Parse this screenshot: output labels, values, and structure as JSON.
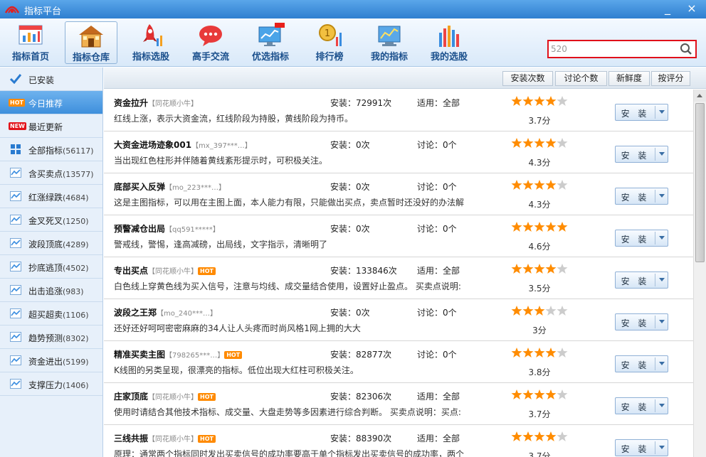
{
  "window": {
    "title": "指标平台",
    "minimize": "_",
    "close": "×"
  },
  "toolbar": {
    "items": [
      {
        "label": "指标首页",
        "icon": "home-chart-icon"
      },
      {
        "label": "指标仓库",
        "icon": "warehouse-icon",
        "active": true
      },
      {
        "label": "指标选股",
        "icon": "rocket-icon"
      },
      {
        "label": "高手交流",
        "icon": "chat-bubble-icon"
      },
      {
        "label": "优选指标",
        "icon": "monitor-chart-icon",
        "badge": "new"
      },
      {
        "label": "排行榜",
        "icon": "medal-icon"
      },
      {
        "label": "我的指标",
        "icon": "my-chart-icon"
      },
      {
        "label": "我的选股",
        "icon": "bar-chart-icon"
      }
    ]
  },
  "search": {
    "value": "520",
    "placeholder": ""
  },
  "sidebar": {
    "items": [
      {
        "label": "已安装",
        "count": "",
        "icon": "checkmark-icon"
      },
      {
        "label": "今日推荐",
        "count": "",
        "icon": "hot-badge-icon",
        "badge": "HOT",
        "active": true
      },
      {
        "label": "最近更新",
        "count": "",
        "icon": "new-badge-icon",
        "badge": "NEW"
      },
      {
        "label": "全部指标",
        "count": "(56117)",
        "icon": "grid-icon"
      },
      {
        "label": "含买卖点",
        "count": "(13577)",
        "icon": "line-chart-icon"
      },
      {
        "label": "红涨绿跌",
        "count": "(4684)",
        "icon": "line-chart-icon"
      },
      {
        "label": "金叉死叉",
        "count": "(1250)",
        "icon": "line-chart-icon"
      },
      {
        "label": "波段顶底",
        "count": "(4289)",
        "icon": "line-chart-icon"
      },
      {
        "label": "抄底逃顶",
        "count": "(4502)",
        "icon": "line-chart-icon"
      },
      {
        "label": "出击追涨",
        "count": "(983)",
        "icon": "line-chart-icon"
      },
      {
        "label": "超买超卖",
        "count": "(1106)",
        "icon": "line-chart-icon"
      },
      {
        "label": "趋势预测",
        "count": "(8302)",
        "icon": "line-chart-icon"
      },
      {
        "label": "资金进出",
        "count": "(5199)",
        "icon": "line-chart-icon"
      },
      {
        "label": "支撑压力",
        "count": "(1406)",
        "icon": "line-chart-icon"
      }
    ]
  },
  "sortbar": {
    "buttons": [
      "安装次数",
      "讨论个数",
      "新鲜度",
      "按评分"
    ]
  },
  "list": {
    "install_label": "安 装",
    "rows": [
      {
        "name": "资金拉升",
        "author": "【同花顺小牛】",
        "hot": false,
        "desc": "红线上涨，表示大资金流，红线阶段为持股，黄线阶段为持币。",
        "installs": "安装：72991次",
        "fit": "适用：全部",
        "rating": 4,
        "score": "3.7分"
      },
      {
        "name": "大资金进场迹象001",
        "author": "【mx_397***…】",
        "hot": false,
        "desc": "当出现红色柱形并伴随着黄线紊形提示时，可积极关注。",
        "installs": "安装：0次",
        "fit": "讨论：0个",
        "rating": 4,
        "score": "4.3分"
      },
      {
        "name": "底部买入反弹",
        "author": "【mo_223***…】",
        "hot": false,
        "desc": "这是主图指标，可以用在主图上面，本人能力有限，只能做出买点，卖点暂时还没好的办法解",
        "installs": "安装：0次",
        "fit": "讨论：0个",
        "rating": 4,
        "score": "4.3分"
      },
      {
        "name": "预警减仓出局",
        "author": "【qq591*****】",
        "hot": false,
        "desc": "警戒线，警惕，逢高减磅，出局线，文字指示，清晰明了",
        "installs": "安装：0次",
        "fit": "讨论：0个",
        "rating": 5,
        "score": "4.6分"
      },
      {
        "name": "专出买点",
        "author": "【同花顺小牛】",
        "hot": true,
        "desc": "白色线上穿黄色线为买入信号，注意与均线、成交量结合使用，设置好止盈点。  买卖点说明:",
        "installs": "安装：133846次",
        "fit": "适用：全部",
        "rating": 4,
        "score": "3.5分"
      },
      {
        "name": "波段之王郑",
        "author": "【mo_240***…】",
        "hot": false,
        "desc": "还好还好呵呵密密麻麻的34人让人头疼而时尚风格1网上拥的大大",
        "installs": "安装：0次",
        "fit": "讨论：0个",
        "rating": 3,
        "score": "3分"
      },
      {
        "name": "精准买卖主图",
        "author": "【798265***…】",
        "hot": true,
        "desc": "K线图的另类呈现，很漂亮的指标。低位出现大红柱可积极关注。",
        "installs": "安装：82877次",
        "fit": "讨论：0个",
        "rating": 4,
        "score": "3.8分"
      },
      {
        "name": "庄家顶底",
        "author": "【同花顺小牛】",
        "hot": true,
        "desc": "使用时请结合其他技术指标、成交量、大盘走势等多因素进行综合判断。  买卖点说明：买点:",
        "installs": "安装：82306次",
        "fit": "适用：全部",
        "rating": 4,
        "score": "3.7分"
      },
      {
        "name": "三线共振",
        "author": "【同花顺小牛】",
        "hot": true,
        "desc": "原理：通常两个指标同时发出买卖信号的成功率要高于单个指标发出买卖信号的成功率，两个",
        "installs": "安装：88390次",
        "fit": "适用：全部",
        "rating": 4,
        "score": "3.7分"
      }
    ]
  },
  "colors": {
    "accent": "#2f7fd0",
    "star": "#ff8c00",
    "star_empty": "#cccccc",
    "highlight": "#e0101a"
  }
}
